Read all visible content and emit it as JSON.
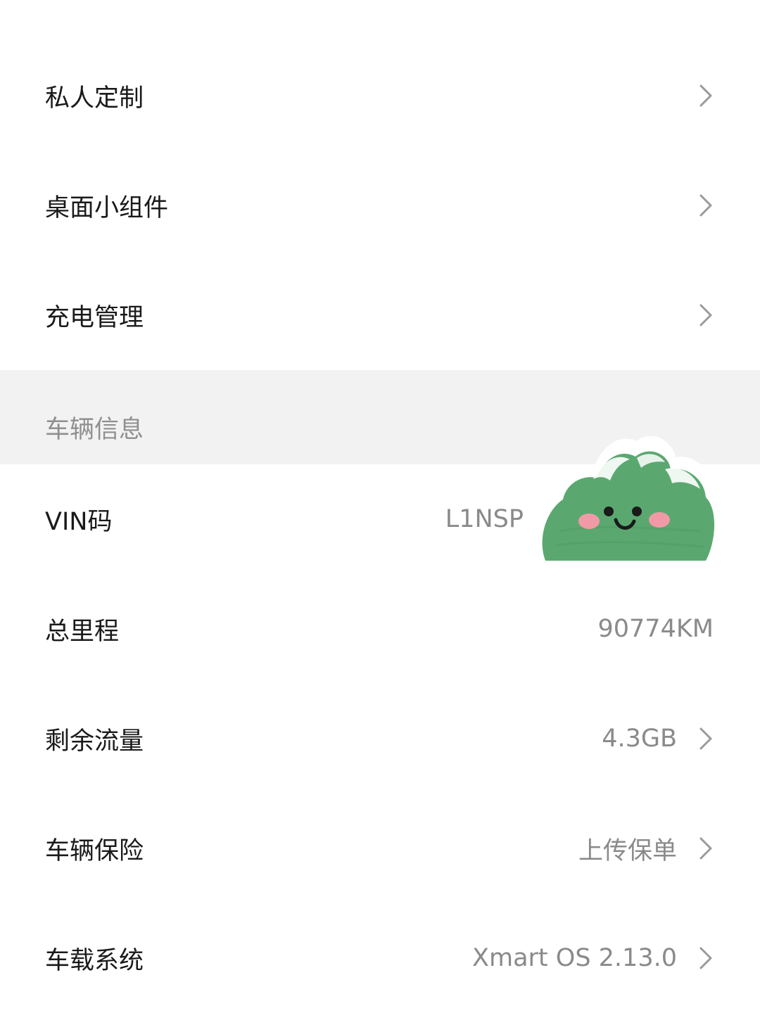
{
  "settings": {
    "personal_custom": {
      "label": "私人定制"
    },
    "desktop_widgets": {
      "label": "桌面小组件"
    },
    "charging": {
      "label": "充电管理"
    }
  },
  "vehicle_info": {
    "section_title": "车辆信息",
    "vin": {
      "label": "VIN码",
      "value": "L1NSP"
    },
    "mileage": {
      "label": "总里程",
      "value": "90774KM"
    },
    "data_remaining": {
      "label": "剩余流量",
      "value": "4.3GB"
    },
    "insurance": {
      "label": "车辆保险",
      "value": "上传保单"
    },
    "system": {
      "label": "车载系统",
      "value": "Xmart OS 2.13.0"
    }
  },
  "colors": {
    "background": "#ffffff",
    "section_bg": "#f2f2f2",
    "label_text": "#1a1a1a",
    "value_text": "#8a8a8a",
    "chevron": "#9a9a9a",
    "sticker_green": "#5aa870"
  },
  "icons": {
    "chevron": "chevron-right-icon",
    "sticker": "cloud-face-sticker"
  }
}
